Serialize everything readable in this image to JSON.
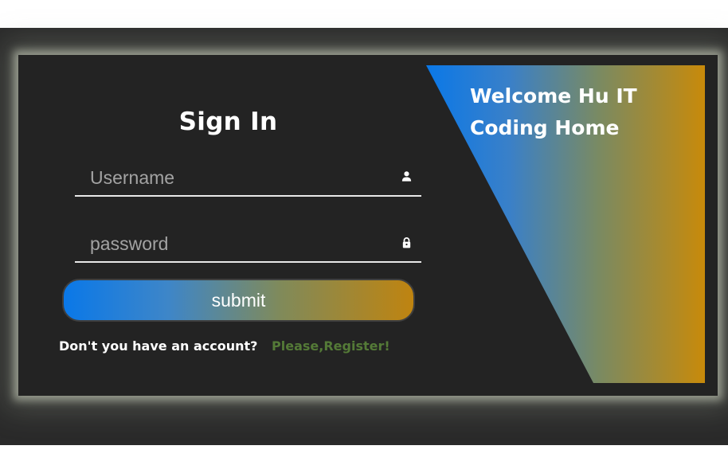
{
  "login": {
    "title": "Sign In",
    "username": {
      "placeholder": "Username",
      "value": "",
      "icon": "user-icon"
    },
    "password": {
      "placeholder": "password",
      "value": "",
      "icon": "lock-icon"
    },
    "submit_label": "submit",
    "register_prompt": "Don't you have an account?",
    "register_link": "Please,Register!"
  },
  "banner": {
    "welcome_text": "Welcome Hu IT Coding Home"
  },
  "colors": {
    "background": "#232323",
    "gradient_start": "#0a78e8",
    "gradient_end": "#c88a0a",
    "link": "#547a37"
  }
}
